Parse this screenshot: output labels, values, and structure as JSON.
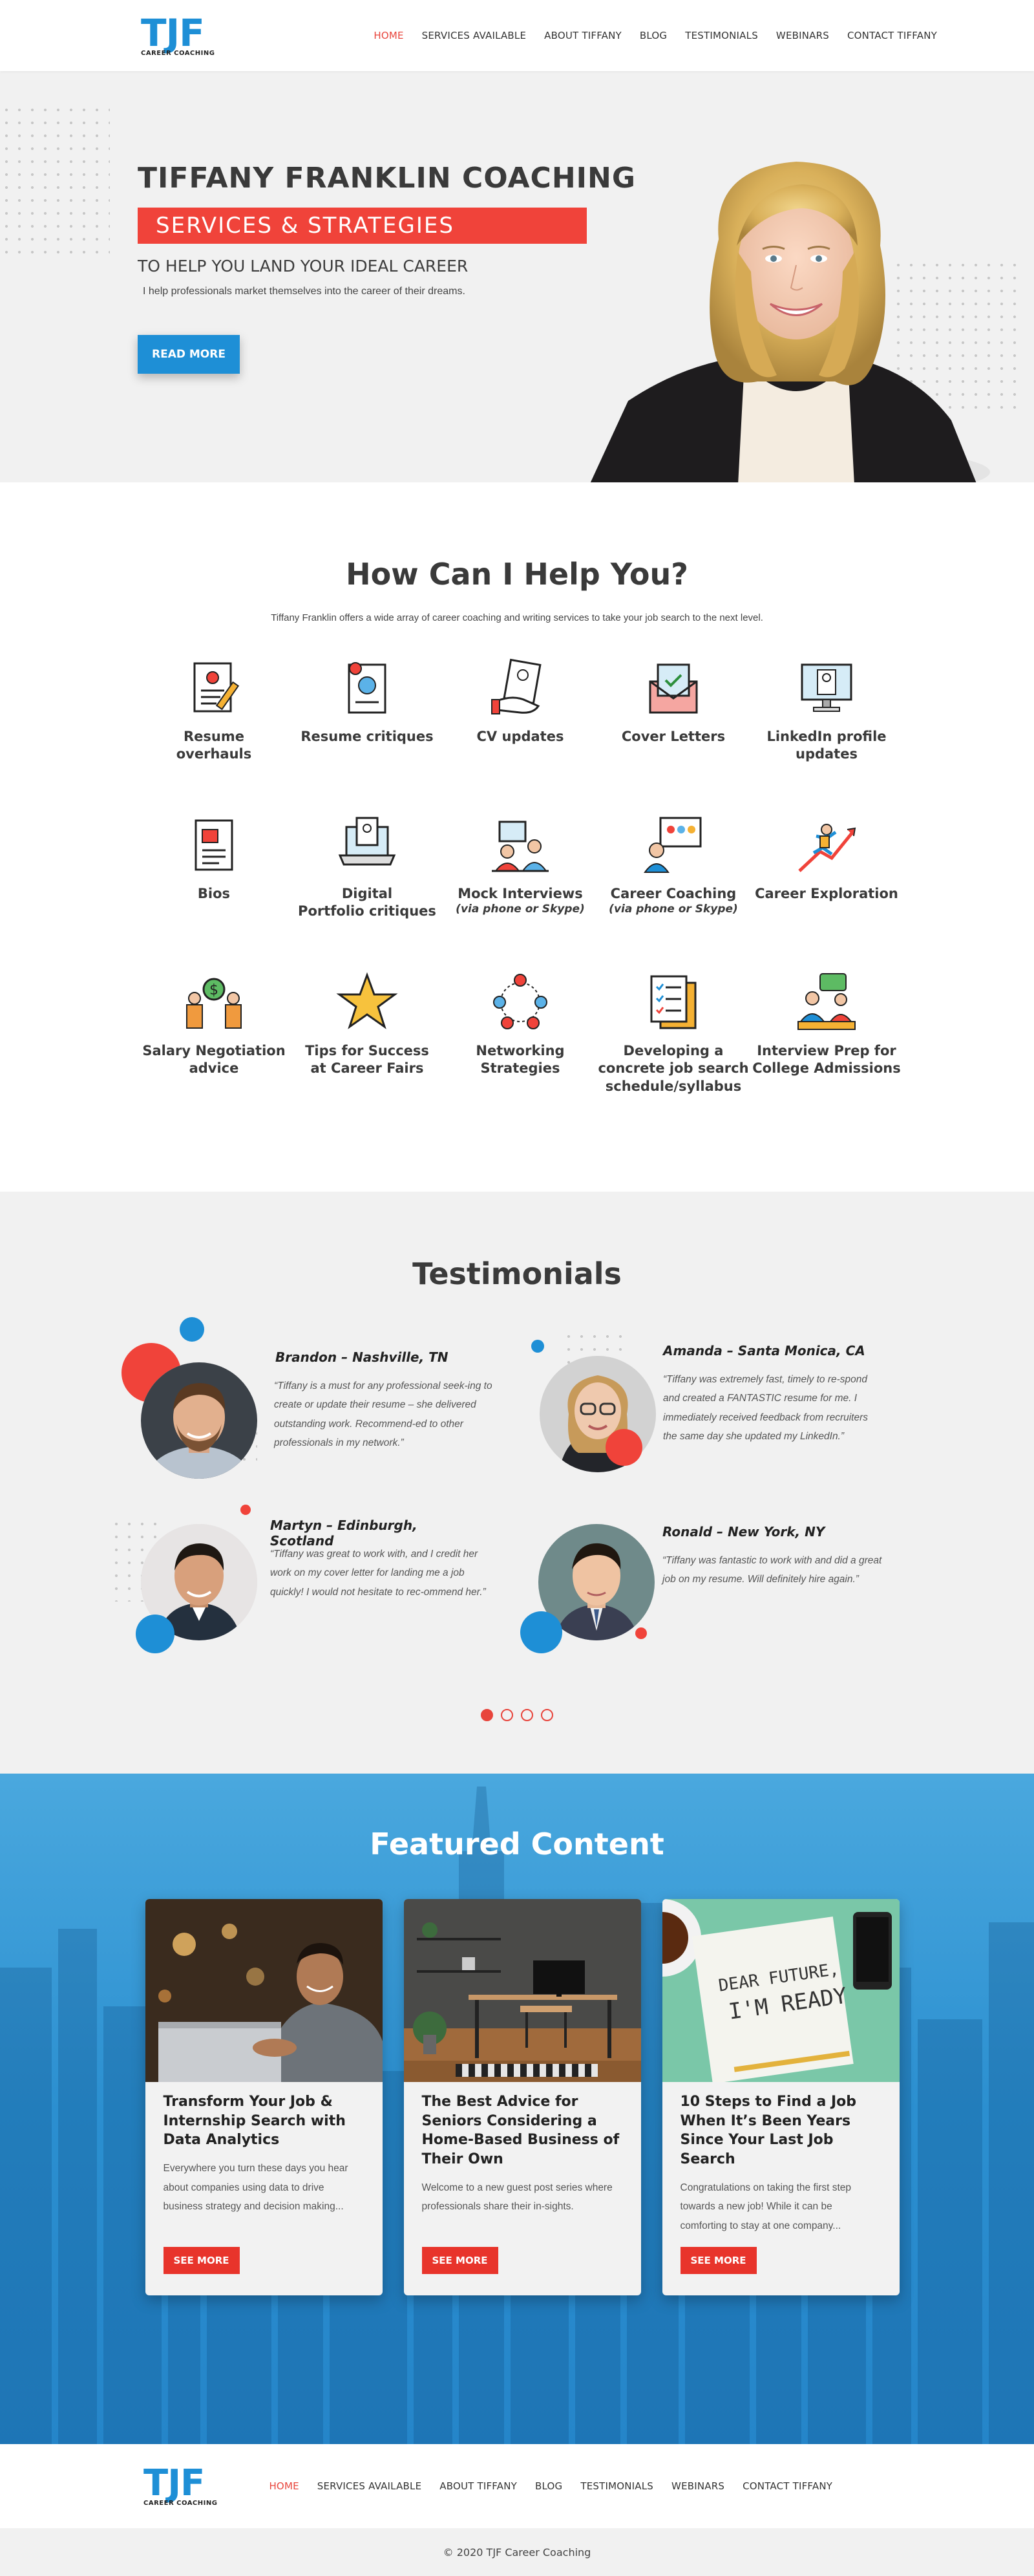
{
  "brand": {
    "logo": "TJF",
    "tagline": "CAREER COACHING",
    "accent": "#1e8fd6",
    "red": "#f0433a"
  },
  "nav": [
    {
      "label": "HOME",
      "active": true
    },
    {
      "label": "SERVICES AVAILABLE"
    },
    {
      "label": "ABOUT TIFFANY"
    },
    {
      "label": "BLOG"
    },
    {
      "label": "TESTIMONIALS"
    },
    {
      "label": "WEBINARS"
    },
    {
      "label": "CONTACT TIFFANY"
    }
  ],
  "hero": {
    "title": "TIFFANY FRANKLIN COACHING",
    "band": "SERVICES & STRATEGIES",
    "subtitle": "TO HELP YOU LAND YOUR IDEAL CAREER",
    "line": "I help professionals market themselves into the career of their dreams.",
    "button": "READ MORE"
  },
  "services": {
    "title": "How Can I Help You?",
    "description": "Tiffany Franklin offers a wide array of career coaching and writing services to take your job search to the next level.",
    "items": [
      {
        "label": "Resume\noverhauls",
        "icon": "resume-icon"
      },
      {
        "label": "Resume critiques",
        "icon": "resume-critique-icon"
      },
      {
        "label": "CV updates",
        "icon": "cv-icon"
      },
      {
        "label": "Cover Letters",
        "icon": "envelope-icon"
      },
      {
        "label": "LinkedIn profile\nupdates",
        "icon": "monitor-profile-icon"
      },
      {
        "label": "Bios",
        "icon": "bio-icon"
      },
      {
        "label": "Digital\nPortfolio critiques",
        "icon": "laptop-icon"
      },
      {
        "label": "Mock Interviews",
        "note": "(via phone or Skype)",
        "icon": "interview-icon"
      },
      {
        "label": "Career Coaching",
        "note": "(via phone or Skype)",
        "icon": "coaching-icon"
      },
      {
        "label": "Career Exploration",
        "icon": "climber-icon"
      },
      {
        "label": "Salary Negotiation\nadvice",
        "icon": "salary-icon"
      },
      {
        "label": "Tips for Success\nat Career Fairs",
        "icon": "star-icon"
      },
      {
        "label": "Networking\nStrategies",
        "icon": "network-icon"
      },
      {
        "label": "Developing a\nconcrete job search\nschedule/syllabus",
        "icon": "checklist-icon"
      },
      {
        "label": "Interview Prep for\nCollege Admissions",
        "icon": "college-prep-icon"
      }
    ]
  },
  "testimonials": {
    "title": "Testimonials",
    "items": [
      {
        "name": "Brandon – Nashville, TN",
        "quote": "“Tiffany is a must for any professional seek-ing to create or update their resume – she delivered outstanding work. Recommend-ed to other professionals in my network.”"
      },
      {
        "name": "Amanda – Santa Monica, CA",
        "quote": "“Tiffany was extremely fast, timely to re-spond and created a FANTASTIC resume for me. I immediately received feedback from recruiters the same day she updated my LinkedIn.”"
      },
      {
        "name": "Martyn – Edinburgh, Scotland",
        "quote": "“Tiffany was great to work with, and I credit her work on my cover letter for landing me a job quickly! I would not hesitate to rec-ommend her.”"
      },
      {
        "name": "Ronald – New York, NY",
        "quote": "“Tiffany was fantastic to work with and did a great job on my resume. Will definitely hire again.”"
      }
    ],
    "pages": 4,
    "current_page": 1
  },
  "featured": {
    "title": "Featured Content",
    "cards": [
      {
        "title": "Transform Your Job & Internship Search with Data Analytics",
        "excerpt": "Everywhere you turn these days you hear about companies using data to drive business strategy and decision making...",
        "button": "SEE MORE"
      },
      {
        "title": "The Best Advice for Seniors Considering a Home-Based Business of Their Own",
        "excerpt": "Welcome to a new guest post series where professionals share their in-sights.",
        "button": "SEE MORE"
      },
      {
        "title": "10 Steps to Find a Job When It’s Been Years Since Your Last Job Search",
        "excerpt": "Congratulations on taking the first step towards a new job! While it can be comforting to stay at one company...",
        "button": "SEE MORE"
      }
    ],
    "note_text_1": "DEAR FUTURE,",
    "note_text_2": "I'M READY"
  },
  "footer": {
    "copyright": "© 2020 TJF Career Coaching"
  }
}
